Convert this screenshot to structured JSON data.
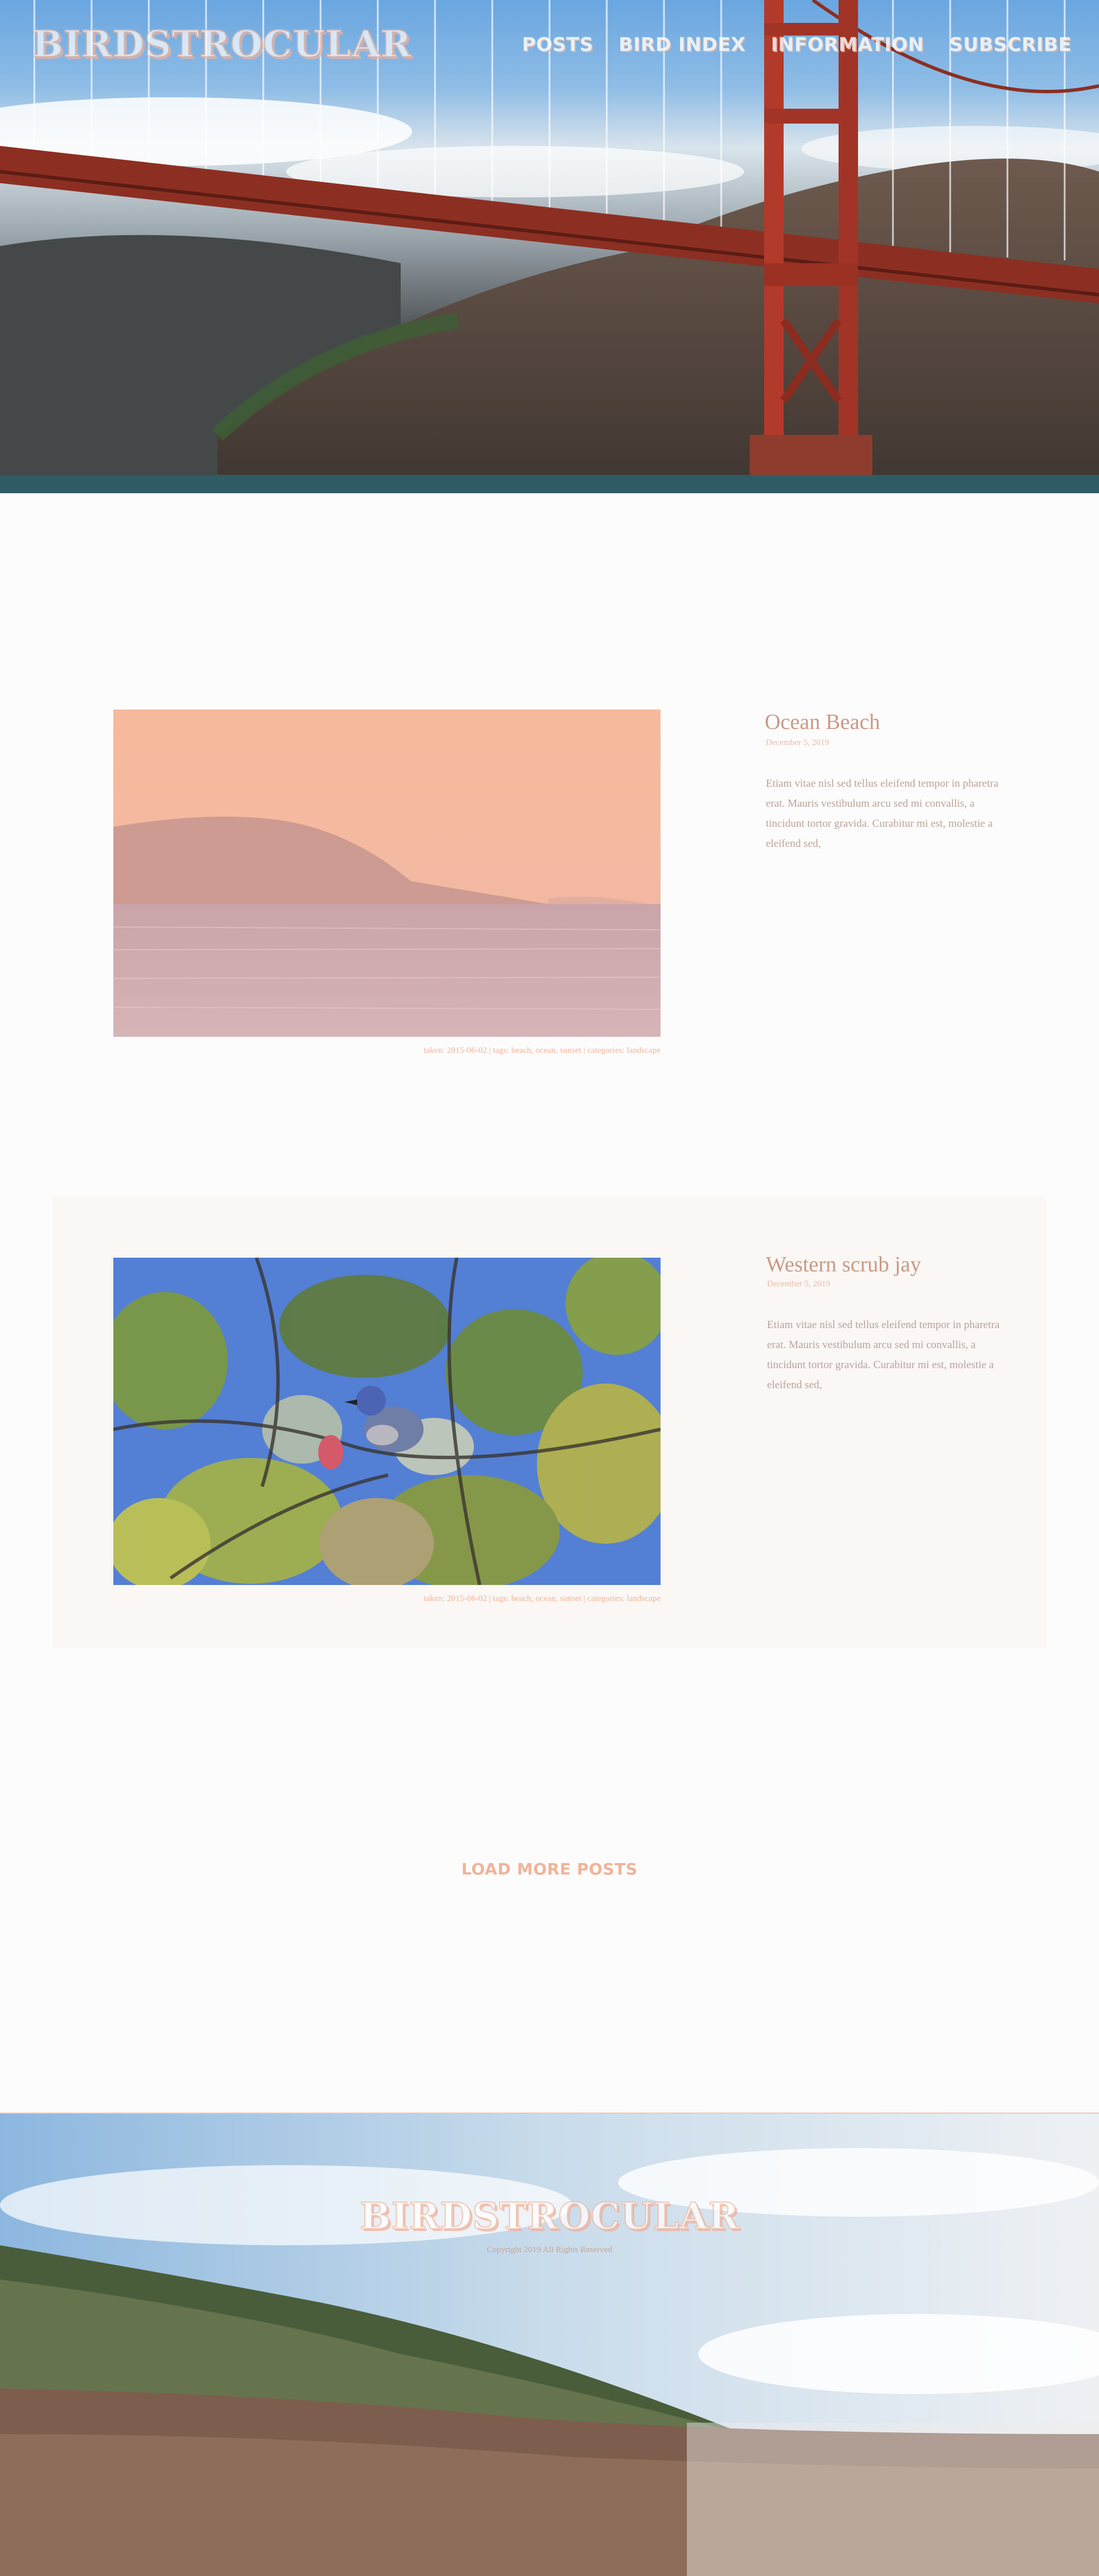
{
  "site": {
    "logo": "BIRDSTROCULAR"
  },
  "nav": {
    "items": [
      "Posts",
      "Bird Index",
      "Information",
      "Subscribe"
    ]
  },
  "posts": [
    {
      "title": "Ocean Beach",
      "date": "December 5, 2019",
      "excerpt": "Etiam vitae nisl sed tellus eleifend tempor in pharetra erat. Mauris vestibulum arcu sed mi convallis, a tincidunt tortor gravida. Curabitur mi est, molestie a eleifend sed,",
      "meta": "taken: 2015-06-02 | tags: beach, ocean, sunset | categories: landscape"
    },
    {
      "title": "Western scrub jay",
      "date": "December 5, 2019",
      "excerpt": "Etiam vitae nisl sed tellus eleifend tempor in pharetra erat. Mauris vestibulum arcu sed mi convallis, a tincidunt tortor gravida. Curabitur mi est, molestie a eleifend sed,",
      "meta": "taken: 2015-06-02 | tags: beach, ocean, sunset | categories: landscape"
    }
  ],
  "load_more": "Load more posts",
  "footer": {
    "logo": "BIRDSTROCULAR",
    "copyright": "Copyright 2019 All Rights Reserved"
  },
  "colors": {
    "accent": "#f0b49a",
    "title": "#c99a86",
    "body": "#b9a49a",
    "card_bg": "#faf7f5"
  }
}
